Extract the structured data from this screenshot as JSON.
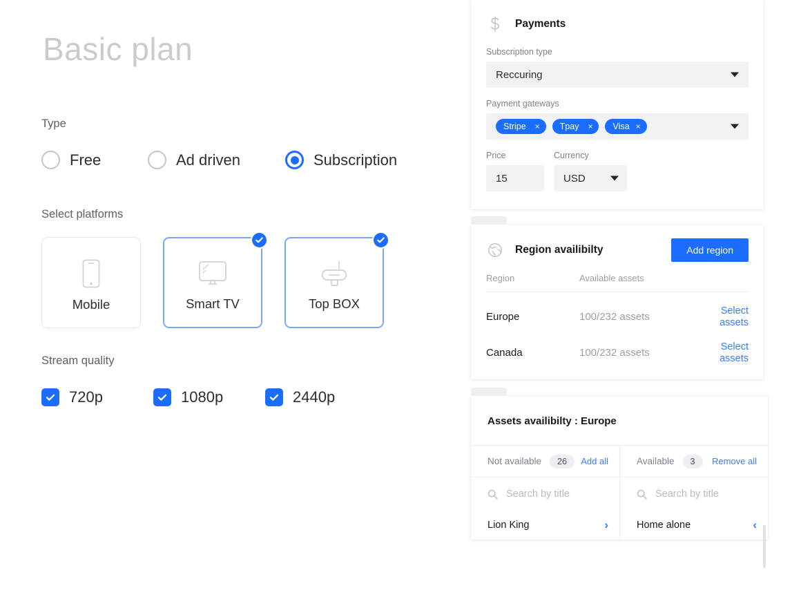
{
  "plan": {
    "title": "Basic plan"
  },
  "type": {
    "label": "Type",
    "options": [
      {
        "label": "Free",
        "selected": false
      },
      {
        "label": "Ad driven",
        "selected": false
      },
      {
        "label": "Subscription",
        "selected": true
      }
    ]
  },
  "platforms": {
    "label": "Select platforms",
    "items": [
      {
        "label": "Mobile",
        "icon": "mobile-phone-icon",
        "selected": false
      },
      {
        "label": "Smart TV",
        "icon": "television-icon",
        "selected": true
      },
      {
        "label": "Top BOX",
        "icon": "set-top-box-icon",
        "selected": true
      }
    ]
  },
  "stream_quality": {
    "label": "Stream quality",
    "options": [
      {
        "label": "720p",
        "checked": true
      },
      {
        "label": "1080p",
        "checked": true
      },
      {
        "label": "2440p",
        "checked": true
      }
    ]
  },
  "payments": {
    "icon": "dollar-sign-icon",
    "title": "Payments",
    "subscription_type": {
      "label": "Subscription type",
      "value": "Reccuring"
    },
    "payment_gateways": {
      "label": "Payment gateways",
      "chips": [
        "Stripe",
        "Tpay",
        "Visa"
      ],
      "remove_glyph": "×"
    },
    "price": {
      "label": "Price",
      "value": "15"
    },
    "currency": {
      "label": "Currency",
      "value": "USD"
    }
  },
  "region": {
    "icon": "globe-icon",
    "title": "Region availibilty",
    "add_button": "Add region",
    "columns": [
      "Region",
      "Available assets",
      ""
    ],
    "rows": [
      {
        "region": "Europe",
        "assets": "100/232 assets",
        "action": "Select assets"
      },
      {
        "region": "Canada",
        "assets": "100/232 assets",
        "action": "Select assets"
      }
    ]
  },
  "assets": {
    "title": "Assets availibilty : Europe",
    "columns": [
      {
        "header": "Not available",
        "count": "26",
        "action": "Add all",
        "search_placeholder": "Search by title",
        "search_value": "",
        "arrow_glyph": "›",
        "items": [
          "Lion King"
        ]
      },
      {
        "header": "Available",
        "count": "3",
        "action": "Remove all",
        "search_placeholder": "Search by title",
        "search_value": "",
        "arrow_glyph": "‹",
        "items": [
          "Home alone"
        ]
      }
    ]
  },
  "colors": {
    "accent": "#1a6dff",
    "link": "#3a7bfa",
    "field_bg": "#f1f2f4",
    "muted_text": "#9b9ea4",
    "title_grey": "#c9cbcf"
  }
}
